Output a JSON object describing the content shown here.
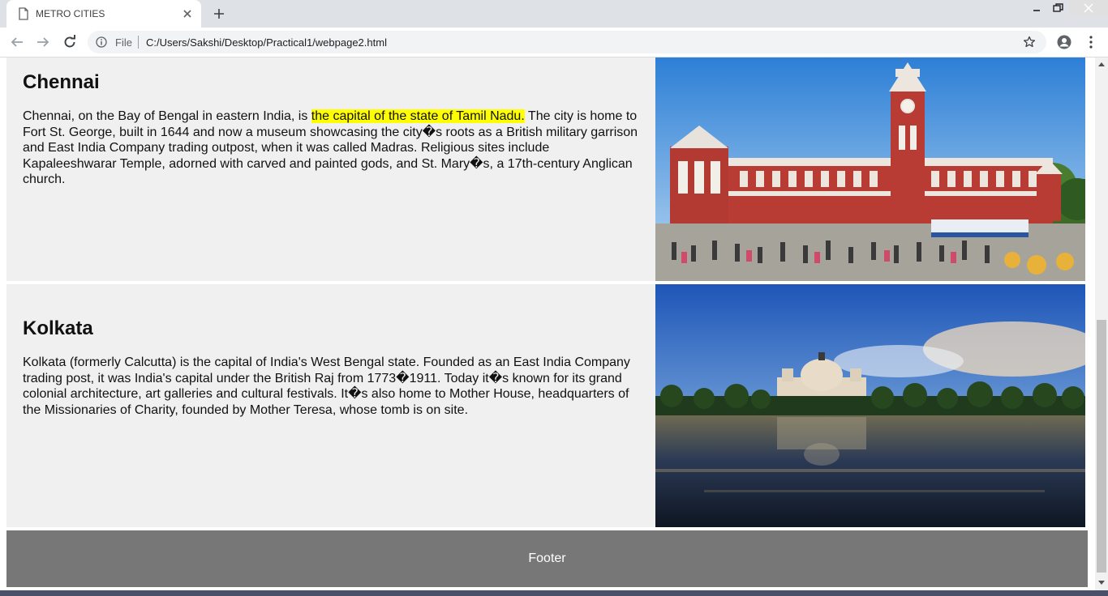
{
  "browser": {
    "tab_title": "METRO CITIES",
    "omnibox_scheme": "File",
    "url": "C:/Users/Sakshi/Desktop/Practical1/webpage2.html"
  },
  "page": {
    "chennai": {
      "heading": "Chennai",
      "text_before": "Chennai, on the Bay of Bengal in eastern India, is ",
      "highlight": "the capital of the state of Tamil Nadu.",
      "text_after": " The city is home to Fort St. George, built in 1644 and now a museum showcasing the city�s roots as a British military garrison and East India Company trading outpost, when it was called Madras. Religious sites include Kapaleeshwarar Temple, adorned with carved and painted gods, and St. Mary�s, a 17th-century Anglican church."
    },
    "kolkata": {
      "heading": "Kolkata",
      "text": "Kolkata (formerly Calcutta) is the capital of India's West Bengal state. Founded as an East India Company trading post, it was India's capital under the British Raj from 1773�1911. Today it�s known for its grand colonial architecture, art galleries and cultural festivals. It�s also home to Mother House, headquarters of the Missionaries of Charity, founded by Mother Teresa, whose tomb is on site."
    },
    "footer": "Footer"
  },
  "colors": {
    "section_bg": "#f0f0f0",
    "highlight": "#ffff00",
    "footer_bg": "#777777"
  }
}
